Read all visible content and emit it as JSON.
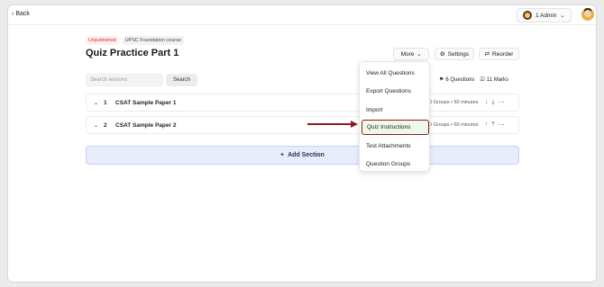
{
  "header": {
    "back_label": "Back",
    "admin_label": "1 Admin"
  },
  "course": {
    "status_badge": "Unpublished",
    "course_badge": "UPSC Foundation course",
    "title": "Quiz Practice Part 1"
  },
  "toolbar": {
    "more_label": "More",
    "settings_label": "Settings",
    "reorder_label": "Reorder"
  },
  "search": {
    "placeholder": "Search lessons",
    "button_label": "Search"
  },
  "stats": {
    "questions": "6 Questions",
    "marks": "11 Marks"
  },
  "sections": [
    {
      "num": "1",
      "name": "CSAT Sample Paper 1",
      "meta": "0 Groups  •  60 minutes"
    },
    {
      "num": "2",
      "name": "CSAT Sample Paper 2",
      "meta": "0 Groups  •  60 minutes"
    }
  ],
  "add_section_label": "Add Section",
  "menu": {
    "items": [
      "View All Questions",
      "Export Questions",
      "Import",
      "Quiz Instructions",
      "Test Attachments",
      "Question Groups"
    ],
    "highlighted_index": 3
  },
  "colors": {
    "unpublished": "#d12f2f",
    "highlight_border": "#8c1b1b",
    "highlight_fill": "#eef7ea",
    "add_section_bg": "#e9ecfb"
  }
}
